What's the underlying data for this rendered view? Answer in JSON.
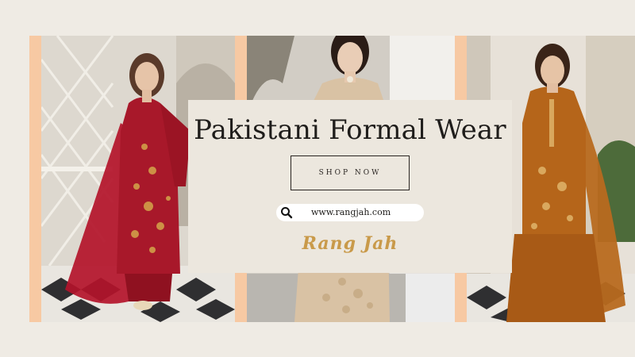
{
  "banner": {
    "title": "Pakistani Formal Wear",
    "shop_button_label": "SHOP NOW",
    "search": {
      "icon": "search-icon",
      "url_text": "www.rangjah.com"
    },
    "logo_text": "Rang Jah",
    "colors": {
      "background": "#efebe4",
      "frame": "#f7c9a3",
      "card": "#ece7de",
      "logo": "#c99a4a",
      "dress_red": "#a8182a",
      "dress_beige": "#d9c2a4",
      "dress_mustard": "#b5651a"
    }
  },
  "photos": [
    {
      "name": "model-red-dress"
    },
    {
      "name": "model-beige-dress"
    },
    {
      "name": "model-mustard-dress"
    }
  ]
}
